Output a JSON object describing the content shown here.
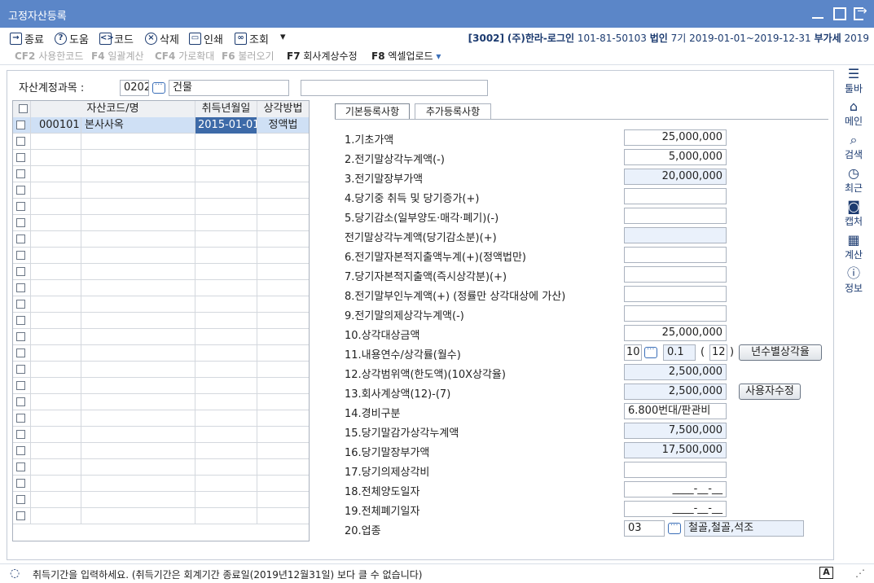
{
  "window": {
    "title": "고정자산등록"
  },
  "toolbar": {
    "close": "종료",
    "help": "도움",
    "code": "코드",
    "delete": "삭제",
    "print": "인쇄",
    "lookup": "조회",
    "more": "▾"
  },
  "company_info": {
    "code": "[3002]",
    "name": "(주)한라-로그인",
    "biz_no": "101-81-50103",
    "type": "법인",
    "period": "7기 2019-01-01~2019-12-31",
    "vat_label": "부가세",
    "vat_year": "2019"
  },
  "fkeys": [
    {
      "key": "CF2",
      "label": "사용한코드"
    },
    {
      "key": "F4",
      "label": "일괄계산"
    },
    {
      "key": "CF4",
      "label": "가로확대"
    },
    {
      "key": "F6",
      "label": "불러오기"
    },
    {
      "key": "F7",
      "label": "회사계상수정"
    },
    {
      "key": "F8",
      "label": "엑셀업로드"
    }
  ],
  "fkeys_dropdown": "▾",
  "account": {
    "label": "자산계정과목 :",
    "code": "0202",
    "name": "건물",
    "extra": ""
  },
  "grid": {
    "headers": [
      "",
      "자산코드/명",
      "취득년월일",
      "상각방법"
    ],
    "rows": [
      {
        "code": "000101",
        "name": "본사사옥",
        "date": "2015-01-01",
        "method": "정액법"
      }
    ]
  },
  "tabs": [
    "기본등록사항",
    "추가등록사항"
  ],
  "fields": {
    "f1": {
      "label": "1.기초가액",
      "value": "25,000,000"
    },
    "f2": {
      "label": "2.전기말상각누계액(-)",
      "value": "5,000,000"
    },
    "f3": {
      "label": "3.전기말장부가액",
      "value": "20,000,000"
    },
    "f4": {
      "label": "4.당기중 취득 및 당기증가(+)",
      "value": ""
    },
    "f5": {
      "label": "5.당기감소(일부양도·매각·폐기)(-)",
      "value": ""
    },
    "f5b": {
      "label": "전기말상각누계액(당기감소분)(+)",
      "value": ""
    },
    "f6": {
      "label": "6.전기말자본적지출액누계(+)(정액법만)",
      "value": ""
    },
    "f7": {
      "label": "7.당기자본적지출액(즉시상각분)(+)",
      "value": ""
    },
    "f8": {
      "label": "8.전기말부인누계액(+) (정률만 상각대상에 가산)",
      "value": ""
    },
    "f9": {
      "label": "9.전기말의제상각누계액(-)",
      "value": ""
    },
    "f10": {
      "label": "10.상각대상금액",
      "value": "25,000,000"
    },
    "f11": {
      "label": "11.내용연수/상각률(월수)",
      "years": "10",
      "rate": "0.1",
      "open_paren": "(",
      "months": "12",
      "close_paren": ")",
      "button": "년수별상각율"
    },
    "f12": {
      "label": "12.상각범위액(한도액)(10X상각율)",
      "value": "2,500,000"
    },
    "f13": {
      "label": "13.회사계상액(12)-(7)",
      "value": "2,500,000",
      "button": "사용자수정"
    },
    "f14": {
      "label": "14.경비구분",
      "value": "6.800번대/판관비"
    },
    "f15": {
      "label": "15.당기말감가상각누계액",
      "value": "7,500,000"
    },
    "f16": {
      "label": "16.당기말장부가액",
      "value": "17,500,000"
    },
    "f17": {
      "label": "17.당기의제상각비",
      "value": ""
    },
    "f18": {
      "label": "18.전체양도일자",
      "value": "____-__-__"
    },
    "f19": {
      "label": "19.전체폐기일자",
      "value": "____-__-__"
    },
    "f20": {
      "label": "20.업종",
      "code": "03",
      "name": "철골,철골,석조"
    }
  },
  "sidemenu": [
    {
      "label": "툴바",
      "icon": "menu-icon"
    },
    {
      "label": "메인",
      "icon": "home-icon"
    },
    {
      "label": "검색",
      "icon": "search-icon"
    },
    {
      "label": "최근",
      "icon": "clock-icon"
    },
    {
      "label": "캡처",
      "icon": "camera-icon"
    },
    {
      "label": "계산",
      "icon": "calculator-icon"
    },
    {
      "label": "정보",
      "icon": "info-icon"
    }
  ],
  "status": {
    "message": "취득기간을 입력하세요. (취득기간은 회계기간 종료일(2019년12월31일) 보다 클 수 없습니다)",
    "ime": "A"
  }
}
